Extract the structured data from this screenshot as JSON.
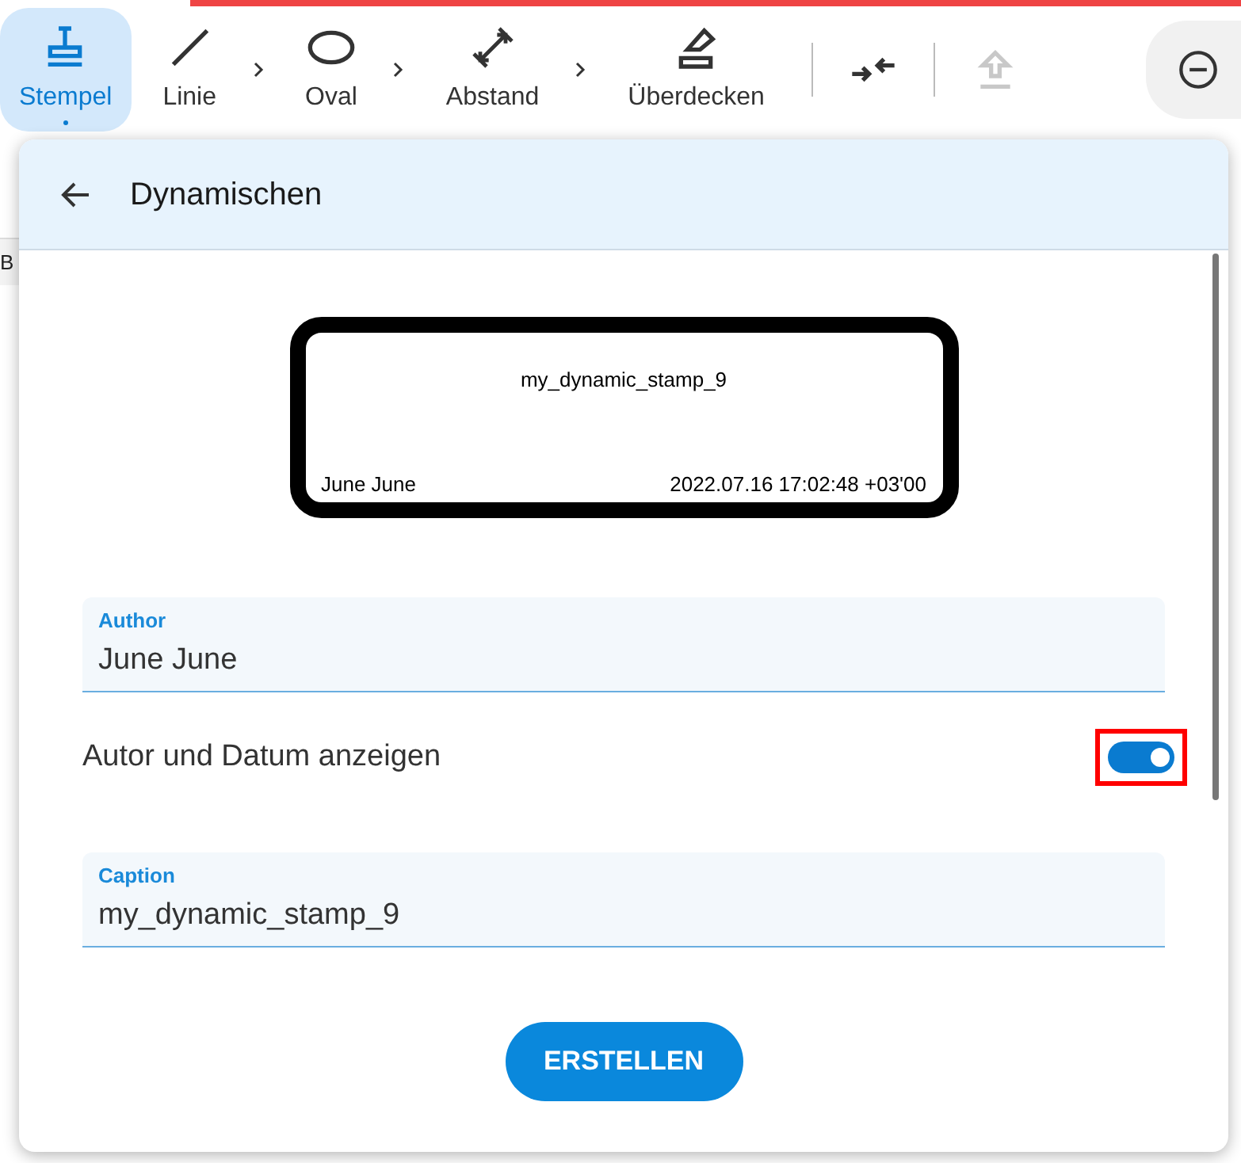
{
  "toolbar": {
    "tools": [
      {
        "label": "Stempel",
        "kind": "stamp",
        "selected": true,
        "submenu": false
      },
      {
        "label": "Linie",
        "kind": "line",
        "selected": false,
        "submenu": true
      },
      {
        "label": "Oval",
        "kind": "oval",
        "selected": false,
        "submenu": true
      },
      {
        "label": "Abstand",
        "kind": "distance",
        "selected": false,
        "submenu": true
      },
      {
        "label": "Überdecken",
        "kind": "eraser",
        "selected": false,
        "submenu": false
      }
    ],
    "actions": [
      {
        "kind": "compress",
        "disabled": false
      },
      {
        "kind": "upload",
        "disabled": true
      }
    ]
  },
  "background": {
    "cut_text": "B"
  },
  "dialog": {
    "title": "Dynamischen",
    "stamp_preview": {
      "caption": "my_dynamic_stamp_9",
      "author": "June June",
      "date": "2022.07.16 17:02:48 +03'00"
    },
    "author_field": {
      "label": "Author",
      "value": "June June"
    },
    "toggle": {
      "label": "Autor und Datum anzeigen",
      "on": true,
      "highlighted": true
    },
    "caption_field": {
      "label": "Caption",
      "value": "my_dynamic_stamp_9"
    },
    "submit": "ERSTELLEN"
  }
}
